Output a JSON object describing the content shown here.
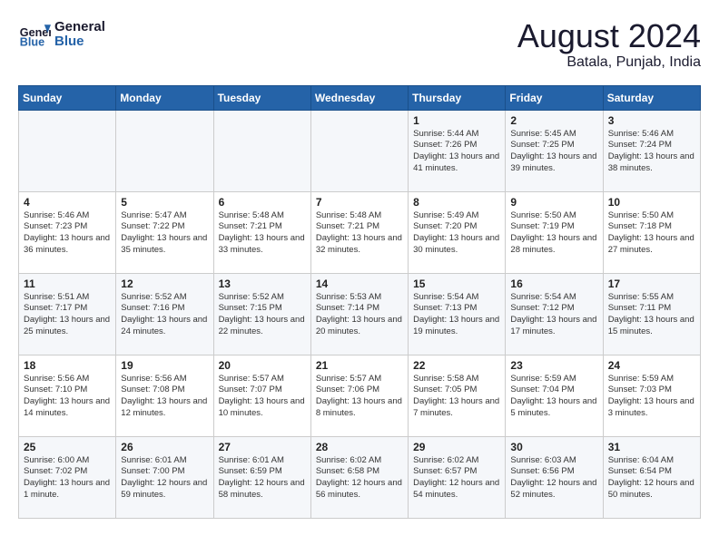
{
  "logo": {
    "text_general": "General",
    "text_blue": "Blue"
  },
  "title": {
    "month_year": "August 2024",
    "location": "Batala, Punjab, India"
  },
  "headers": [
    "Sunday",
    "Monday",
    "Tuesday",
    "Wednesday",
    "Thursday",
    "Friday",
    "Saturday"
  ],
  "rows": [
    [
      {
        "day": "",
        "content": ""
      },
      {
        "day": "",
        "content": ""
      },
      {
        "day": "",
        "content": ""
      },
      {
        "day": "",
        "content": ""
      },
      {
        "day": "1",
        "content": "Sunrise: 5:44 AM\nSunset: 7:26 PM\nDaylight: 13 hours\nand 41 minutes."
      },
      {
        "day": "2",
        "content": "Sunrise: 5:45 AM\nSunset: 7:25 PM\nDaylight: 13 hours\nand 39 minutes."
      },
      {
        "day": "3",
        "content": "Sunrise: 5:46 AM\nSunset: 7:24 PM\nDaylight: 13 hours\nand 38 minutes."
      }
    ],
    [
      {
        "day": "4",
        "content": "Sunrise: 5:46 AM\nSunset: 7:23 PM\nDaylight: 13 hours\nand 36 minutes."
      },
      {
        "day": "5",
        "content": "Sunrise: 5:47 AM\nSunset: 7:22 PM\nDaylight: 13 hours\nand 35 minutes."
      },
      {
        "day": "6",
        "content": "Sunrise: 5:48 AM\nSunset: 7:21 PM\nDaylight: 13 hours\nand 33 minutes."
      },
      {
        "day": "7",
        "content": "Sunrise: 5:48 AM\nSunset: 7:21 PM\nDaylight: 13 hours\nand 32 minutes."
      },
      {
        "day": "8",
        "content": "Sunrise: 5:49 AM\nSunset: 7:20 PM\nDaylight: 13 hours\nand 30 minutes."
      },
      {
        "day": "9",
        "content": "Sunrise: 5:50 AM\nSunset: 7:19 PM\nDaylight: 13 hours\nand 28 minutes."
      },
      {
        "day": "10",
        "content": "Sunrise: 5:50 AM\nSunset: 7:18 PM\nDaylight: 13 hours\nand 27 minutes."
      }
    ],
    [
      {
        "day": "11",
        "content": "Sunrise: 5:51 AM\nSunset: 7:17 PM\nDaylight: 13 hours\nand 25 minutes."
      },
      {
        "day": "12",
        "content": "Sunrise: 5:52 AM\nSunset: 7:16 PM\nDaylight: 13 hours\nand 24 minutes."
      },
      {
        "day": "13",
        "content": "Sunrise: 5:52 AM\nSunset: 7:15 PM\nDaylight: 13 hours\nand 22 minutes."
      },
      {
        "day": "14",
        "content": "Sunrise: 5:53 AM\nSunset: 7:14 PM\nDaylight: 13 hours\nand 20 minutes."
      },
      {
        "day": "15",
        "content": "Sunrise: 5:54 AM\nSunset: 7:13 PM\nDaylight: 13 hours\nand 19 minutes."
      },
      {
        "day": "16",
        "content": "Sunrise: 5:54 AM\nSunset: 7:12 PM\nDaylight: 13 hours\nand 17 minutes."
      },
      {
        "day": "17",
        "content": "Sunrise: 5:55 AM\nSunset: 7:11 PM\nDaylight: 13 hours\nand 15 minutes."
      }
    ],
    [
      {
        "day": "18",
        "content": "Sunrise: 5:56 AM\nSunset: 7:10 PM\nDaylight: 13 hours\nand 14 minutes."
      },
      {
        "day": "19",
        "content": "Sunrise: 5:56 AM\nSunset: 7:08 PM\nDaylight: 13 hours\nand 12 minutes."
      },
      {
        "day": "20",
        "content": "Sunrise: 5:57 AM\nSunset: 7:07 PM\nDaylight: 13 hours\nand 10 minutes."
      },
      {
        "day": "21",
        "content": "Sunrise: 5:57 AM\nSunset: 7:06 PM\nDaylight: 13 hours\nand 8 minutes."
      },
      {
        "day": "22",
        "content": "Sunrise: 5:58 AM\nSunset: 7:05 PM\nDaylight: 13 hours\nand 7 minutes."
      },
      {
        "day": "23",
        "content": "Sunrise: 5:59 AM\nSunset: 7:04 PM\nDaylight: 13 hours\nand 5 minutes."
      },
      {
        "day": "24",
        "content": "Sunrise: 5:59 AM\nSunset: 7:03 PM\nDaylight: 13 hours\nand 3 minutes."
      }
    ],
    [
      {
        "day": "25",
        "content": "Sunrise: 6:00 AM\nSunset: 7:02 PM\nDaylight: 13 hours\nand 1 minute."
      },
      {
        "day": "26",
        "content": "Sunrise: 6:01 AM\nSunset: 7:00 PM\nDaylight: 12 hours\nand 59 minutes."
      },
      {
        "day": "27",
        "content": "Sunrise: 6:01 AM\nSunset: 6:59 PM\nDaylight: 12 hours\nand 58 minutes."
      },
      {
        "day": "28",
        "content": "Sunrise: 6:02 AM\nSunset: 6:58 PM\nDaylight: 12 hours\nand 56 minutes."
      },
      {
        "day": "29",
        "content": "Sunrise: 6:02 AM\nSunset: 6:57 PM\nDaylight: 12 hours\nand 54 minutes."
      },
      {
        "day": "30",
        "content": "Sunrise: 6:03 AM\nSunset: 6:56 PM\nDaylight: 12 hours\nand 52 minutes."
      },
      {
        "day": "31",
        "content": "Sunrise: 6:04 AM\nSunset: 6:54 PM\nDaylight: 12 hours\nand 50 minutes."
      }
    ]
  ]
}
